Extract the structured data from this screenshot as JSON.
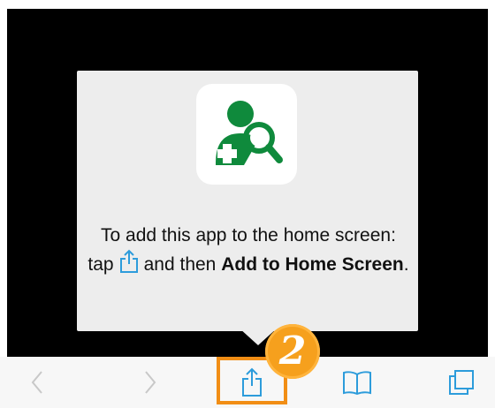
{
  "popover": {
    "text_before": "To add this app to the home screen: tap",
    "text_middle": "and then",
    "bold_action": "Add to Home Screen",
    "text_end": ".",
    "app_icon": "user-search-plus-icon",
    "share_icon": "share-icon"
  },
  "toolbar": {
    "items": [
      {
        "name": "back",
        "icon": "chevron-left-icon"
      },
      {
        "name": "forward",
        "icon": "chevron-right-icon"
      },
      {
        "name": "share",
        "icon": "share-icon"
      },
      {
        "name": "bookmarks",
        "icon": "book-icon"
      },
      {
        "name": "tabs",
        "icon": "tabs-icon"
      }
    ]
  },
  "annotation": {
    "step_number": "2"
  },
  "colors": {
    "ios_blue": "#2d9cdb",
    "app_green": "#0f8a3c",
    "highlight_orange": "#f18e15",
    "popover_bg": "#ededed"
  }
}
